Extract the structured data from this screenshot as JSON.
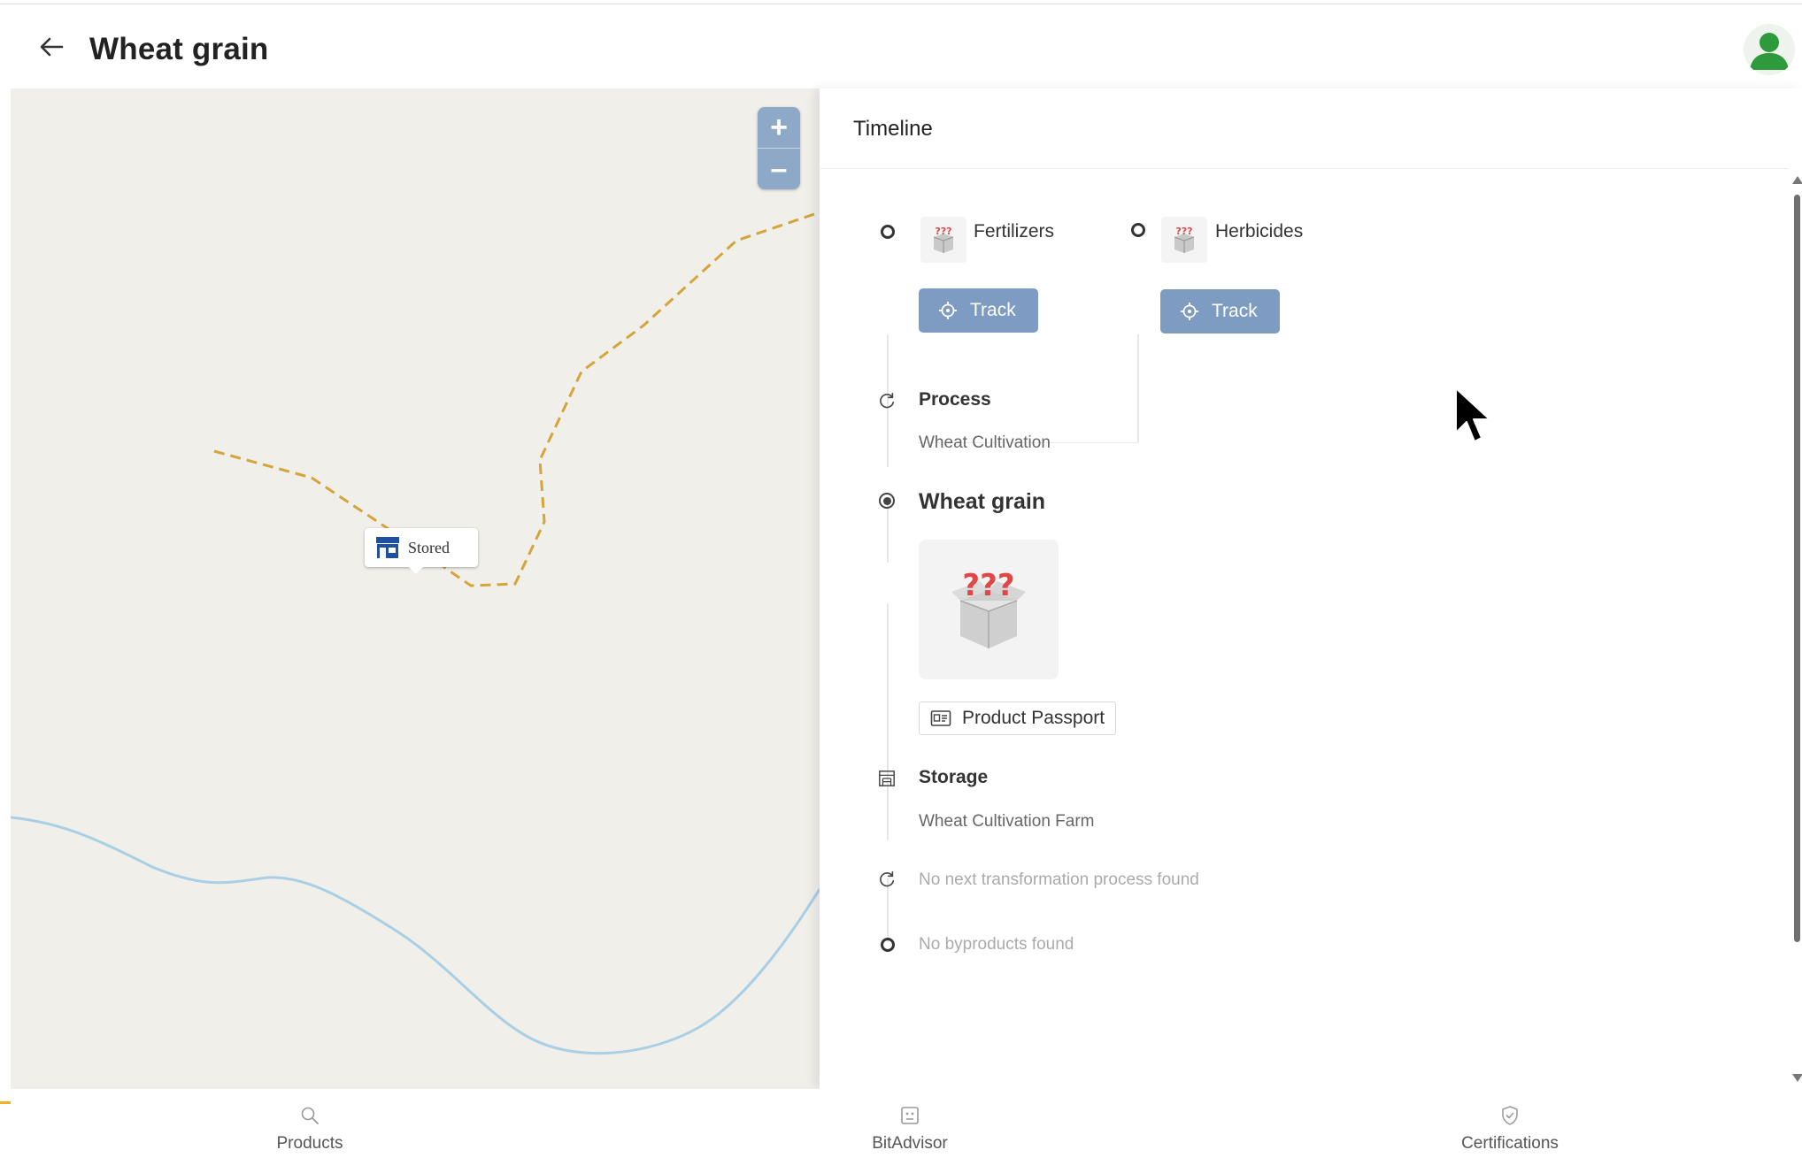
{
  "header": {
    "title": "Wheat grain",
    "back_icon": "arrow-left-icon",
    "avatar_icon": "user-avatar-icon"
  },
  "map": {
    "marker_label": "Stored",
    "marker_icon": "storefront-icon",
    "zoom_in": "+",
    "zoom_out": "–",
    "route_color": "#d3a53a",
    "river_color": "#a9cfe5"
  },
  "timeline": {
    "title": "Timeline",
    "inputs": [
      {
        "name": "Fertilizers",
        "track_label": "Track"
      },
      {
        "name": "Herbicides",
        "track_label": "Track"
      }
    ],
    "process": {
      "label": "Process",
      "value": "Wheat Cultivation"
    },
    "product": {
      "name": "Wheat grain",
      "passport_label": "Product Passport"
    },
    "storage": {
      "label": "Storage",
      "value": "Wheat Cultivation Farm"
    },
    "next_process_empty": "No next transformation process found",
    "byproducts_empty": "No byproducts found"
  },
  "bottom_nav": {
    "items": [
      {
        "label": "Products",
        "icon": "search-icon"
      },
      {
        "label": "BitAdvisor",
        "icon": "advisor-icon"
      },
      {
        "label": "Certifications",
        "icon": "certificate-check-icon"
      }
    ]
  },
  "colors": {
    "accent": "#7e9cc2",
    "avatar": "#2e9a3c",
    "marker_icon": "#1f4fa1",
    "nav_indicator": "#f2b21f"
  }
}
